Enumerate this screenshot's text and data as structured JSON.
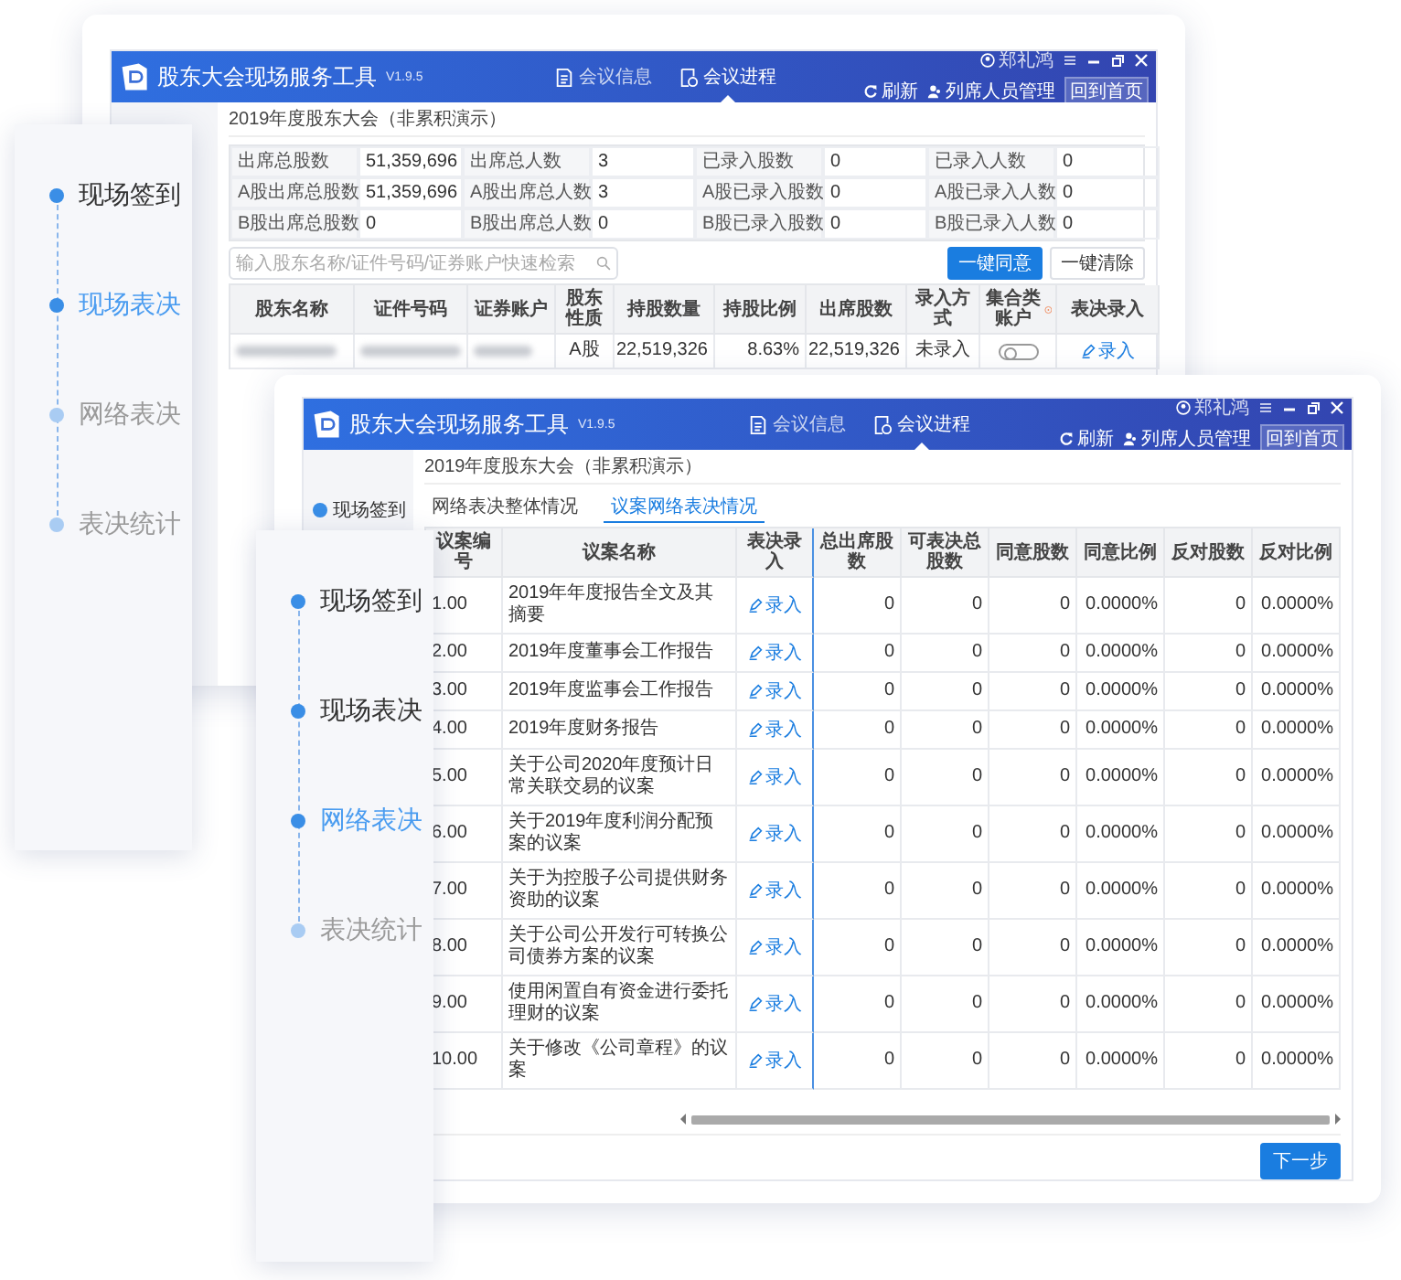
{
  "back_window": {
    "app_title": "股东大会现场服务工具",
    "version": "V1.9.5",
    "user": "郑礼鸿",
    "nav_tabs": [
      {
        "label": "会议信息",
        "selected": false
      },
      {
        "label": "会议进程",
        "selected": true
      }
    ],
    "toolbar": {
      "refresh": "刷新",
      "attendees": "列席人员管理",
      "home": "回到首页"
    },
    "meeting_title": "2019年度股东大会（非累积演示）",
    "stats": [
      {
        "label": "出席总股数",
        "value": "51,359,696"
      },
      {
        "label": "出席总人数",
        "value": "3"
      },
      {
        "label": "已录入股数",
        "value": "0"
      },
      {
        "label": "已录入人数",
        "value": "0"
      },
      {
        "label": "A股出席总股数",
        "value": "51,359,696"
      },
      {
        "label": "A股出席总人数",
        "value": "3"
      },
      {
        "label": "A股已录入股数",
        "value": "0"
      },
      {
        "label": "A股已录入人数",
        "value": "0"
      },
      {
        "label": "B股出席总股数",
        "value": "0"
      },
      {
        "label": "B股出席总人数",
        "value": "0"
      },
      {
        "label": "B股已录入股数",
        "value": "0"
      },
      {
        "label": "B股已录入人数",
        "value": "0"
      }
    ],
    "search": {
      "placeholder": "输入股东名称/证件号码/证券账户快速检索"
    },
    "buttons": [
      {
        "label": "一键同意",
        "primary": true
      },
      {
        "label": "一键清除",
        "primary": false
      }
    ],
    "table": {
      "columns": [
        "股东名称",
        "证件号码",
        "证券账户",
        "股东性质",
        "持股数量",
        "持股比例",
        "出席股数",
        "录入方式",
        "集合类账户",
        "表决录入"
      ],
      "rows": [
        {
          "shareholder_type": "A股",
          "shares": "22,519,326",
          "ratio": "8.63%",
          "attending_shares": "22,519,326",
          "entry_method": "未录入",
          "collective_account": false,
          "action": "录入"
        }
      ]
    }
  },
  "back_steps": [
    {
      "label": "现场签到",
      "completed": true,
      "selected": false
    },
    {
      "label": "现场表决",
      "completed": false,
      "selected": true
    },
    {
      "label": "网络表决",
      "completed": false,
      "selected": false
    },
    {
      "label": "表决统计",
      "completed": false,
      "selected": false
    }
  ],
  "front_window": {
    "app_title": "股东大会现场服务工具",
    "version": "V1.9.5",
    "user": "郑礼鸿",
    "nav_tabs": [
      {
        "label": "会议信息",
        "selected": false
      },
      {
        "label": "会议进程",
        "selected": true
      }
    ],
    "toolbar": {
      "refresh": "刷新",
      "attendees": "列席人员管理",
      "home": "回到首页"
    },
    "meeting_title": "2019年度股东大会（非累积演示）",
    "sidebar": [
      {
        "label": "现场签到"
      }
    ],
    "sub_tabs": [
      {
        "label": "网络表决整体情况",
        "selected": false
      },
      {
        "label": "议案网络表决情况",
        "selected": true
      }
    ],
    "table": {
      "columns": [
        "议案编号",
        "议案名称",
        "表决录入",
        "总出席股数",
        "可表决总股数",
        "同意股数",
        "同意比例",
        "反对股数",
        "反对比例"
      ],
      "rows": [
        {
          "number": "1.00",
          "name": "2019年年度报告全文及其摘要",
          "action": "录入",
          "total": "0",
          "votable": "0",
          "agree": "0",
          "agree_ratio": "0.0000%",
          "oppose": "0",
          "oppose_ratio": "0.0000%"
        },
        {
          "number": "2.00",
          "name": "2019年度董事会工作报告",
          "action": "录入",
          "total": "0",
          "votable": "0",
          "agree": "0",
          "agree_ratio": "0.0000%",
          "oppose": "0",
          "oppose_ratio": "0.0000%"
        },
        {
          "number": "3.00",
          "name": "2019年度监事会工作报告",
          "action": "录入",
          "total": "0",
          "votable": "0",
          "agree": "0",
          "agree_ratio": "0.0000%",
          "oppose": "0",
          "oppose_ratio": "0.0000%"
        },
        {
          "number": "4.00",
          "name": "2019年度财务报告",
          "action": "录入",
          "total": "0",
          "votable": "0",
          "agree": "0",
          "agree_ratio": "0.0000%",
          "oppose": "0",
          "oppose_ratio": "0.0000%"
        },
        {
          "number": "5.00",
          "name": "关于公司2020年度预计日常关联交易的议案",
          "action": "录入",
          "total": "0",
          "votable": "0",
          "agree": "0",
          "agree_ratio": "0.0000%",
          "oppose": "0",
          "oppose_ratio": "0.0000%"
        },
        {
          "number": "6.00",
          "name": "关于2019年度利润分配预案的议案",
          "action": "录入",
          "total": "0",
          "votable": "0",
          "agree": "0",
          "agree_ratio": "0.0000%",
          "oppose": "0",
          "oppose_ratio": "0.0000%"
        },
        {
          "number": "7.00",
          "name": "关于为控股子公司提供财务资助的议案",
          "action": "录入",
          "total": "0",
          "votable": "0",
          "agree": "0",
          "agree_ratio": "0.0000%",
          "oppose": "0",
          "oppose_ratio": "0.0000%"
        },
        {
          "number": "8.00",
          "name": "关于公司公开发行可转换公司债券方案的议案",
          "action": "录入",
          "total": "0",
          "votable": "0",
          "agree": "0",
          "agree_ratio": "0.0000%",
          "oppose": "0",
          "oppose_ratio": "0.0000%"
        },
        {
          "number": "9.00",
          "name": "使用闲置自有资金进行委托理财的议案",
          "action": "录入",
          "total": "0",
          "votable": "0",
          "agree": "0",
          "agree_ratio": "0.0000%",
          "oppose": "0",
          "oppose_ratio": "0.0000%"
        },
        {
          "number": "10.00",
          "name": "关于修改《公司章程》的议案",
          "action": "录入",
          "total": "0",
          "votable": "0",
          "agree": "0",
          "agree_ratio": "0.0000%",
          "oppose": "0",
          "oppose_ratio": "0.0000%"
        }
      ]
    },
    "next_button": "下一步"
  },
  "front_steps": [
    {
      "label": "现场签到",
      "completed": true,
      "selected": false
    },
    {
      "label": "现场表决",
      "completed": true,
      "selected": false
    },
    {
      "label": "网络表决",
      "completed": false,
      "selected": true
    },
    {
      "label": "表决统计",
      "completed": false,
      "selected": false
    }
  ]
}
